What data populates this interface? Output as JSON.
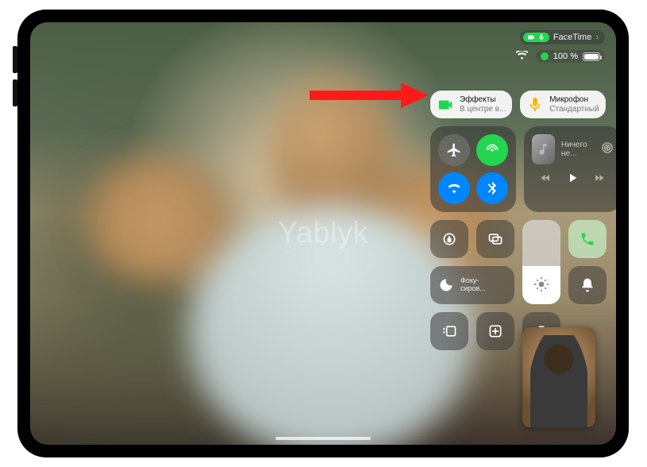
{
  "watermark": "Yablyk",
  "status": {
    "app_label": "FaceTime",
    "battery_text": "100 %"
  },
  "cards": {
    "effects": {
      "title": "Эффекты",
      "subtitle": "В центре в..."
    },
    "mic": {
      "title": "Микрофон",
      "subtitle": "Стандартный"
    }
  },
  "media": {
    "title": "Ничего не..."
  },
  "focus": {
    "line1": "Фоку-",
    "line2": "сиров..."
  }
}
